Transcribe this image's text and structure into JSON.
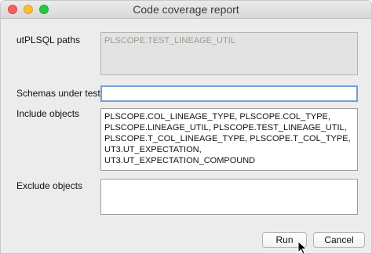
{
  "window": {
    "title": "Code coverage report"
  },
  "form": {
    "utplsql_paths": {
      "label": "utPLSQL paths",
      "value": "PLSCOPE.TEST_LINEAGE_UTIL"
    },
    "schemas_under_test": {
      "label": "Schemas under test",
      "value": ""
    },
    "include_objects": {
      "label": "Include objects",
      "value": "PLSCOPE.COL_LINEAGE_TYPE, PLSCOPE.COL_TYPE,\nPLSCOPE.LINEAGE_UTIL, PLSCOPE.TEST_LINEAGE_UTIL,\nPLSCOPE.T_COL_LINEAGE_TYPE, PLSCOPE.T_COL_TYPE,\nUT3.UT_EXPECTATION, UT3.UT_EXPECTATION_COMPOUND"
    },
    "exclude_objects": {
      "label": "Exclude objects",
      "value": ""
    }
  },
  "buttons": {
    "run_label": "Run",
    "cancel_label": "Cancel"
  },
  "icons": {
    "close": "close-icon",
    "minimize": "minimize-icon",
    "zoom": "zoom-icon",
    "cursor": "mouse-pointer-icon"
  }
}
